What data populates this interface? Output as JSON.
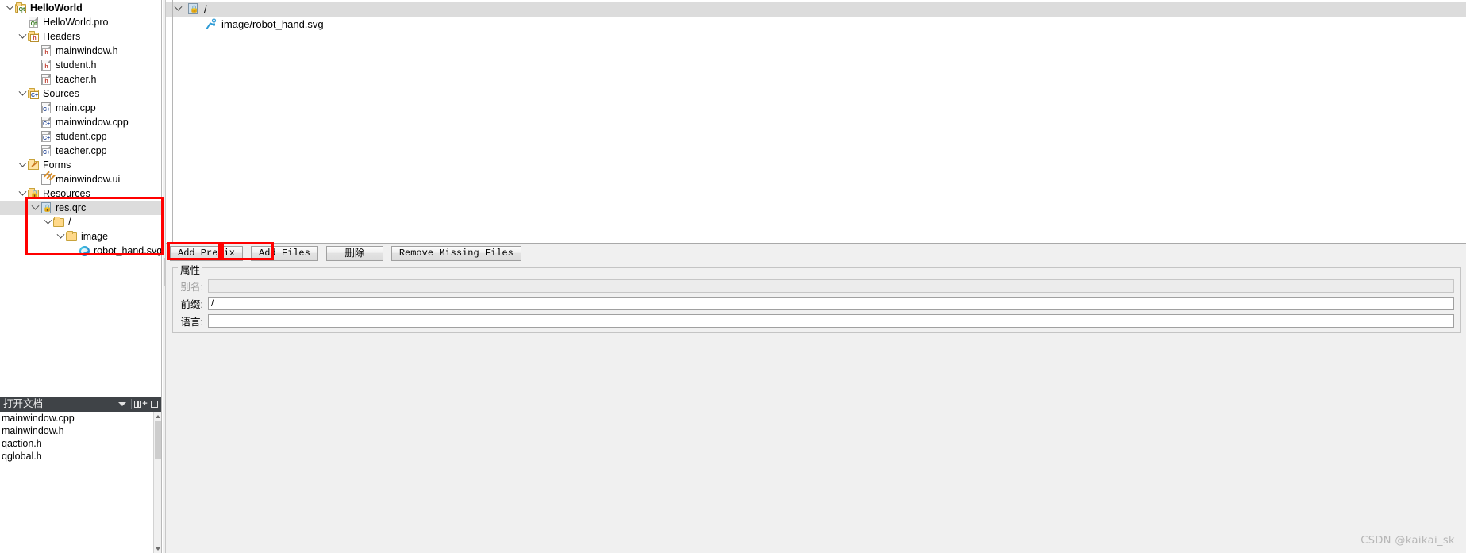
{
  "project_tree": {
    "nodes": [
      {
        "label": "HelloWorld",
        "depth": 0,
        "icon": "qt-folder-icon",
        "expanded": true,
        "bold": true,
        "selected": false
      },
      {
        "label": "HelloWorld.pro",
        "depth": 1,
        "icon": "qt-pro-file-icon",
        "expanded": null,
        "bold": false,
        "selected": false
      },
      {
        "label": "Headers",
        "depth": 1,
        "icon": "headers-folder-icon",
        "expanded": true,
        "bold": false,
        "selected": false
      },
      {
        "label": "mainwindow.h",
        "depth": 2,
        "icon": "h-file-icon",
        "expanded": null,
        "bold": false,
        "selected": false
      },
      {
        "label": "student.h",
        "depth": 2,
        "icon": "h-file-icon",
        "expanded": null,
        "bold": false,
        "selected": false
      },
      {
        "label": "teacher.h",
        "depth": 2,
        "icon": "h-file-icon",
        "expanded": null,
        "bold": false,
        "selected": false
      },
      {
        "label": "Sources",
        "depth": 1,
        "icon": "sources-folder-icon",
        "expanded": true,
        "bold": false,
        "selected": false
      },
      {
        "label": "main.cpp",
        "depth": 2,
        "icon": "cpp-file-icon",
        "expanded": null,
        "bold": false,
        "selected": false
      },
      {
        "label": "mainwindow.cpp",
        "depth": 2,
        "icon": "cpp-file-icon",
        "expanded": null,
        "bold": false,
        "selected": false
      },
      {
        "label": "student.cpp",
        "depth": 2,
        "icon": "cpp-file-icon",
        "expanded": null,
        "bold": false,
        "selected": false
      },
      {
        "label": "teacher.cpp",
        "depth": 2,
        "icon": "cpp-file-icon",
        "expanded": null,
        "bold": false,
        "selected": false
      },
      {
        "label": "Forms",
        "depth": 1,
        "icon": "forms-folder-icon",
        "expanded": true,
        "bold": false,
        "selected": false
      },
      {
        "label": "mainwindow.ui",
        "depth": 2,
        "icon": "ui-file-icon",
        "expanded": null,
        "bold": false,
        "selected": false
      },
      {
        "label": "Resources",
        "depth": 1,
        "icon": "resources-folder-icon",
        "expanded": true,
        "bold": false,
        "selected": false
      },
      {
        "label": "res.qrc",
        "depth": 2,
        "icon": "qrc-file-icon",
        "expanded": true,
        "bold": false,
        "selected": true
      },
      {
        "label": "/",
        "depth": 3,
        "icon": "folder-icon",
        "expanded": true,
        "bold": false,
        "selected": false
      },
      {
        "label": "image",
        "depth": 4,
        "icon": "folder-icon",
        "expanded": true,
        "bold": false,
        "selected": false
      },
      {
        "label": "robot_hand.svg",
        "depth": 5,
        "icon": "edge-browser-icon",
        "expanded": null,
        "bold": false,
        "selected": false
      }
    ]
  },
  "open_documents": {
    "title": "打开文档",
    "caret_icon": "chevron-down-icon",
    "split_icon": "split-view-add-icon",
    "items": [
      {
        "label": "mainwindow.cpp"
      },
      {
        "label": "mainwindow.h"
      },
      {
        "label": "qaction.h"
      },
      {
        "label": "qglobal.h"
      }
    ]
  },
  "resource_editor": {
    "tree": [
      {
        "label": "/",
        "depth": 0,
        "icon": "qrc-prefix-icon",
        "expanded": true,
        "selected": true
      },
      {
        "label": "image/robot_hand.svg",
        "depth": 1,
        "icon": "robot-arm-icon",
        "expanded": null,
        "selected": false
      }
    ],
    "buttons": [
      {
        "label": "Add Prefix",
        "name": "add-prefix-button",
        "mono": true,
        "highlighted": true
      },
      {
        "label": "Add Files",
        "name": "add-files-button",
        "mono": true,
        "highlighted": true
      },
      {
        "label": "删除",
        "name": "delete-button",
        "mono": false,
        "highlighted": false
      },
      {
        "label": "Remove Missing Files",
        "name": "remove-missing-files-button",
        "mono": true,
        "highlighted": false
      }
    ],
    "properties": {
      "title": "属性",
      "fields": [
        {
          "label": "别名:",
          "value": "",
          "name": "alias-field",
          "disabled": true
        },
        {
          "label": "前缀:",
          "value": "/",
          "name": "prefix-field",
          "disabled": false
        },
        {
          "label": "语言:",
          "value": "",
          "name": "language-field",
          "disabled": false
        }
      ]
    }
  },
  "watermark": {
    "text": "CSDN @kaikai_sk"
  },
  "colors": {
    "highlight": "#ff0000",
    "selection": "#dcdcdc",
    "panel_header": "#3f4347",
    "chrome": "#f0f0f0"
  }
}
